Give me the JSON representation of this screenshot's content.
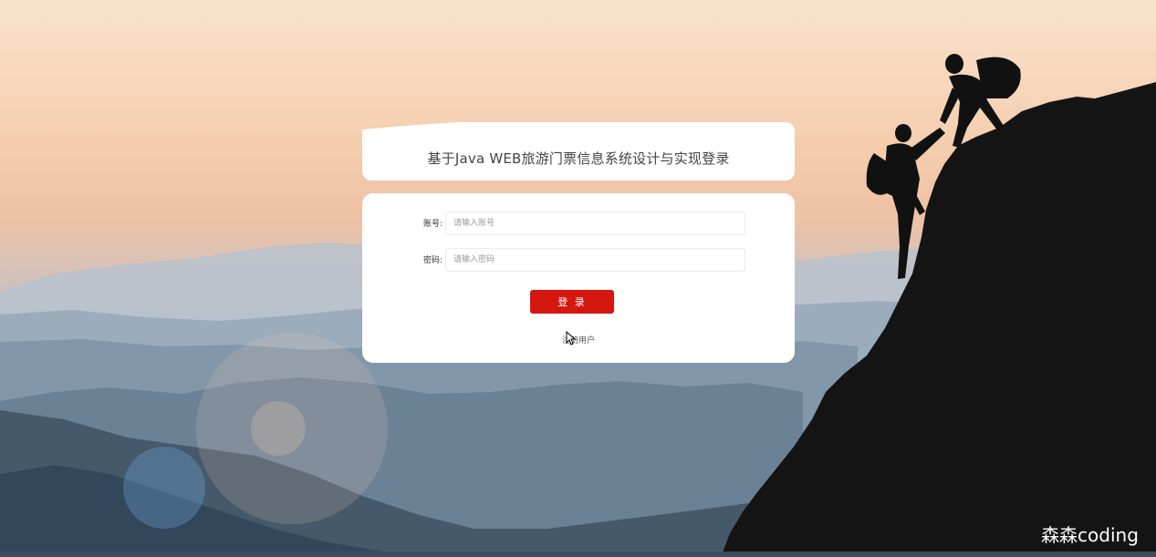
{
  "page": {
    "title": "基于Java WEB旅游门票信息系统设计与实现登录"
  },
  "form": {
    "username_label": "账号:",
    "username_placeholder": "请输入账号",
    "password_label": "密码:",
    "password_placeholder": "请输入密码",
    "login_button": "登 录",
    "register_link": "注册用户"
  },
  "watermark": "森森coding",
  "colors": {
    "login_button": "#d41810",
    "card": "#ffffff",
    "sky_top": "#f9e2cc",
    "sky_mid": "#f0c2a4",
    "mountains": "#6c8498"
  }
}
